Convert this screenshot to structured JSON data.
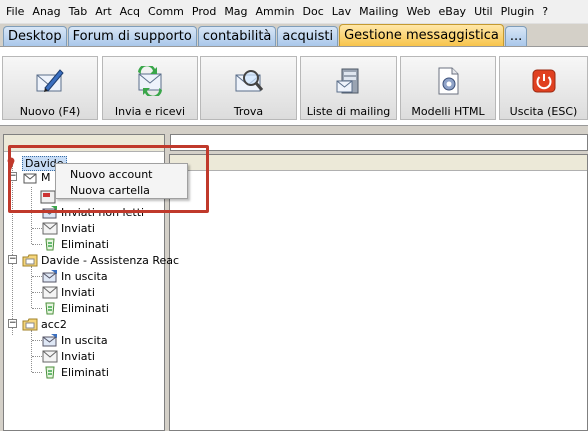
{
  "menubar": {
    "items": [
      "File",
      "Anag",
      "Tab",
      "Art",
      "Acq",
      "Comm",
      "Prod",
      "Mag",
      "Ammin",
      "Doc",
      "Lav",
      "Mailing",
      "Web",
      "eBay",
      "Util",
      "Plugin",
      "?"
    ]
  },
  "tabs": [
    {
      "label": "Desktop",
      "active": false
    },
    {
      "label": "Forum di supporto",
      "active": false
    },
    {
      "label": "contabilità",
      "active": false
    },
    {
      "label": "acquisti",
      "active": false
    },
    {
      "label": "Gestione messaggistica",
      "active": true
    },
    {
      "label": "...",
      "active": false
    }
  ],
  "toolbar": {
    "buttons": [
      {
        "label": "Nuovo (F4)",
        "icon": "new-message-icon"
      },
      {
        "label": "Invia e ricevi",
        "icon": "send-receive-icon"
      },
      {
        "label": "Trova",
        "icon": "find-icon"
      },
      {
        "label": "Liste di mailing",
        "icon": "mailing-lists-icon"
      },
      {
        "label": "Modelli HTML",
        "icon": "html-templates-icon"
      },
      {
        "label": "Uscita (ESC)",
        "icon": "exit-icon"
      }
    ]
  },
  "tree": {
    "root_label": "Davide",
    "account1_label": "M",
    "hidden_item_label": "Inviati non letti",
    "account1_children": [
      "Inviati",
      "Eliminati"
    ],
    "account2_label": "Davide - Assistenza Reac",
    "account2_children": [
      "In uscita",
      "Inviati",
      "Eliminati"
    ],
    "account3_label": "acc2",
    "account3_children": [
      "In uscita",
      "Inviati",
      "Eliminati"
    ]
  },
  "context_menu": {
    "items": [
      "Nuovo account",
      "Nuova cartella"
    ]
  },
  "colors": {
    "active_tab": "#f7c44c",
    "inactive_tab": "#a9c7ea",
    "annotation": "#c0392b",
    "exit_button": "#e04020"
  }
}
